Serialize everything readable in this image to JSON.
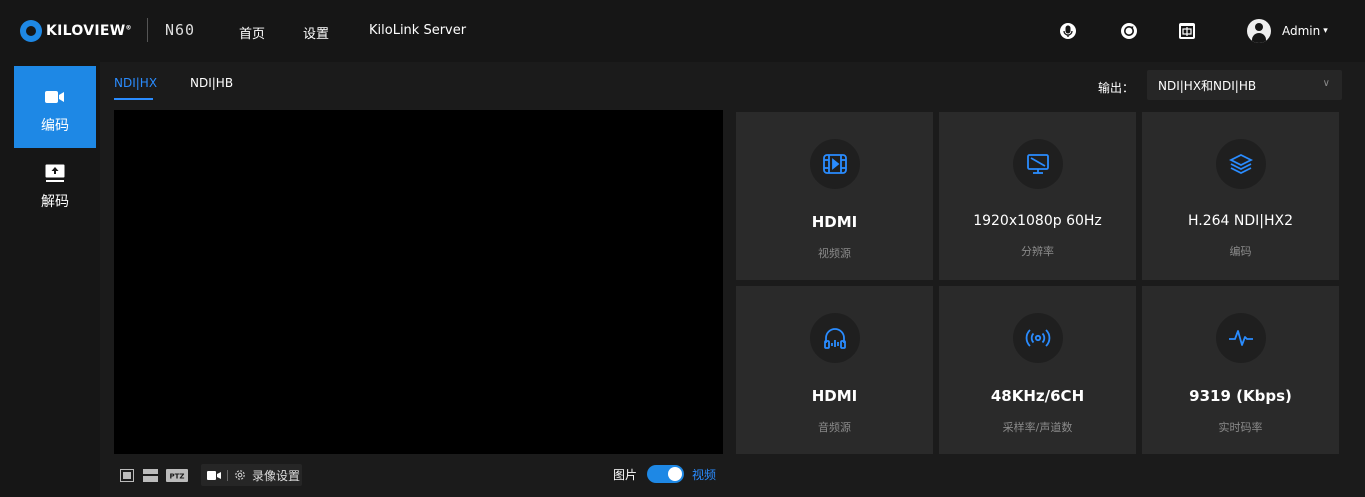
{
  "header": {
    "brand": "KILOVIEW",
    "brand_reg": "®",
    "model": "N60",
    "nav": [
      {
        "label": "首页"
      },
      {
        "label": "设置"
      },
      {
        "label": "KiloLink Server"
      }
    ],
    "user": {
      "name": "Admin",
      "caret": "▾"
    }
  },
  "sidebar": {
    "items": [
      {
        "label": "编码",
        "icon": "camera-icon",
        "active": true
      },
      {
        "label": "解码",
        "icon": "monitor-upload-icon",
        "active": false
      }
    ]
  },
  "tabs": [
    {
      "label": "NDI|HX",
      "active": true
    },
    {
      "label": "NDI|HB",
      "active": false
    }
  ],
  "output": {
    "label": "输出：",
    "value": "NDI|HX和NDI|HB",
    "arrow": "∨"
  },
  "stats": [
    {
      "value": "HDMI",
      "caption": "视频源",
      "icon": "film-play-icon"
    },
    {
      "value": "1920x1080p 60Hz",
      "caption": "分辨率",
      "icon": "monitor-icon"
    },
    {
      "value": "H.264 NDI|HX2",
      "caption": "编码",
      "icon": "layers-icon"
    },
    {
      "value": "HDMI",
      "caption": "音频源",
      "icon": "headphones-icon"
    },
    {
      "value": "48KHz/6CH",
      "caption": "采样率/声道数",
      "icon": "broadcast-icon"
    },
    {
      "value": "9319 (Kbps)",
      "caption": "实时码率",
      "icon": "pulse-icon"
    }
  ],
  "toolbar": {
    "ptz": "PTZ",
    "record_settings": "录像设置",
    "toggle_left": "图片",
    "toggle_right": "视频",
    "toggle_on": true
  },
  "colors": {
    "accent": "#1e88e5",
    "card": "#2a2a2a",
    "bg": "#1b1b1b",
    "header": "#161616"
  }
}
